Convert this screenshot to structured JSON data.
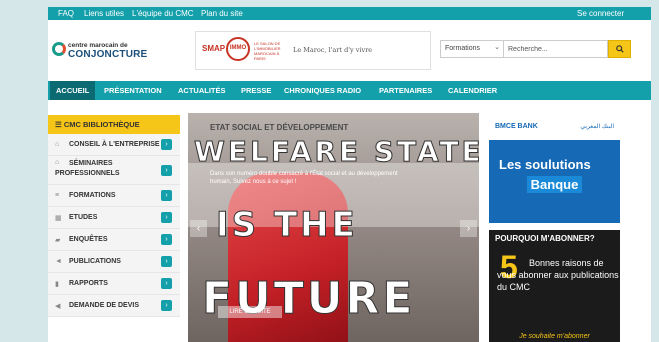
{
  "topbar": {
    "links": [
      "FAQ",
      "Liens utiles",
      "L'équipe du CMC",
      "Plan du site"
    ],
    "login": "Se connecter"
  },
  "logo": {
    "line1": "centre marocain de",
    "line2": "CONJONCTURE"
  },
  "banner": {
    "brand": "SMAP",
    "circle_text": "IMMO",
    "small_text": "LE SALON DE L'IMMOBILIER MAROCAIN À PARIS",
    "tagline": "Le Maroc, l'art d'y vivre"
  },
  "search": {
    "select_value": "Formations",
    "placeholder": "Recherche...",
    "button_icon": "search-icon"
  },
  "nav": {
    "items": [
      "ACCUEIL",
      "PRÉSENTATION",
      "ACTUALITÉS",
      "PRESSE",
      "CHRONIQUES RADIO",
      "PARTENAIRES",
      "CALENDRIER"
    ],
    "active": "ACCUEIL"
  },
  "sidebar": {
    "title": "CMC BIBLIOTHÈQUE",
    "items": [
      {
        "label": "CONSEIL À L'ENTREPRISE",
        "icon": "bank-icon"
      },
      {
        "label": "SÉMINAIRES PROFESSIONNELS",
        "icon": "bank-icon"
      },
      {
        "label": "FORMATIONS",
        "icon": "list-icon"
      },
      {
        "label": "ETUDES",
        "icon": "grid-icon"
      },
      {
        "label": "ENQUÊTES",
        "icon": "chat-icon"
      },
      {
        "label": "PUBLICATIONS",
        "icon": "megaphone-icon"
      },
      {
        "label": "RAPPORTS",
        "icon": "chart-icon"
      },
      {
        "label": "DEMANDE DE DEVIS",
        "icon": "send-icon"
      }
    ]
  },
  "slider": {
    "title": "ETAT SOCIAL ET DÉVELOPPEMENT",
    "body": "Dans son numéro double consacré à l'État social et au développement humain, Suivez nous à ce sujet !",
    "big_lines": [
      "WELFARE STATE",
      "IS THE",
      "FUTURE"
    ],
    "button": "LIRE LA SUITE",
    "colors": {
      "red": "#c22026"
    }
  },
  "ads": {
    "bank": {
      "name": "BMCE BANK",
      "arabic": "البنك المغربي",
      "line1": "Les soulutions",
      "line2": "Banque"
    },
    "subscribe": {
      "title": "POURQUOI M'ABONNER?",
      "number": "5",
      "text": "Bonnes raisons de vous abonner aux publications du CMC",
      "button": "Je souhaite m'abonner"
    }
  },
  "colors": {
    "teal": "#14a0aa",
    "yellow": "#f5c518",
    "dark_teal": "#0b6a72"
  }
}
